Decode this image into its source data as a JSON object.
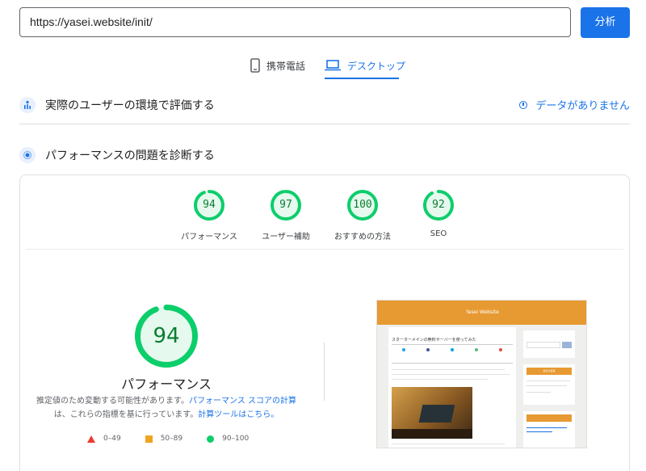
{
  "url_input": {
    "value": "https://yasei.website/init/"
  },
  "analyze_button": "分析",
  "tabs": [
    {
      "label": "携帯電話",
      "icon": "smartphone-icon",
      "active": false
    },
    {
      "label": "デスクトップ",
      "icon": "laptop-icon",
      "active": true
    }
  ],
  "field_data": {
    "title": "実際のユーザーの環境で評価する",
    "no_data": "データがありません"
  },
  "diagnose": {
    "title": "パフォーマンスの問題を診断する"
  },
  "gauges": [
    {
      "score": "94",
      "label": "パフォーマンス"
    },
    {
      "score": "97",
      "label": "ユーザー補助"
    },
    {
      "score": "100",
      "label": "おすすめの方法"
    },
    {
      "score": "92",
      "label": "SEO"
    }
  ],
  "main_score": {
    "score": "94",
    "label": "パフォーマンス",
    "desc_1": "推定値のため変動する可能性があります。",
    "link_1": "パフォーマンス スコアの計算",
    "desc_2": "は、これらの指標を基に行っています。",
    "link_2": "計算ツールはこちら。"
  },
  "legend": [
    {
      "range": "0–49",
      "shape": "triangle",
      "color": "#eb3b2f"
    },
    {
      "range": "50–89",
      "shape": "square",
      "color": "#f1a31f"
    },
    {
      "range": "90–100",
      "shape": "circle",
      "color": "#0cce6b"
    }
  ],
  "preview": {
    "site_title": "Yasei Website",
    "article_title": "スターターメインの無料サーバーを使ってみた",
    "side_heading": "最近の投稿"
  },
  "colors": {
    "accent": "#1a73e8",
    "good": "#0cce6b",
    "good_text": "#0a7d32",
    "site_orange": "#e79a32"
  }
}
